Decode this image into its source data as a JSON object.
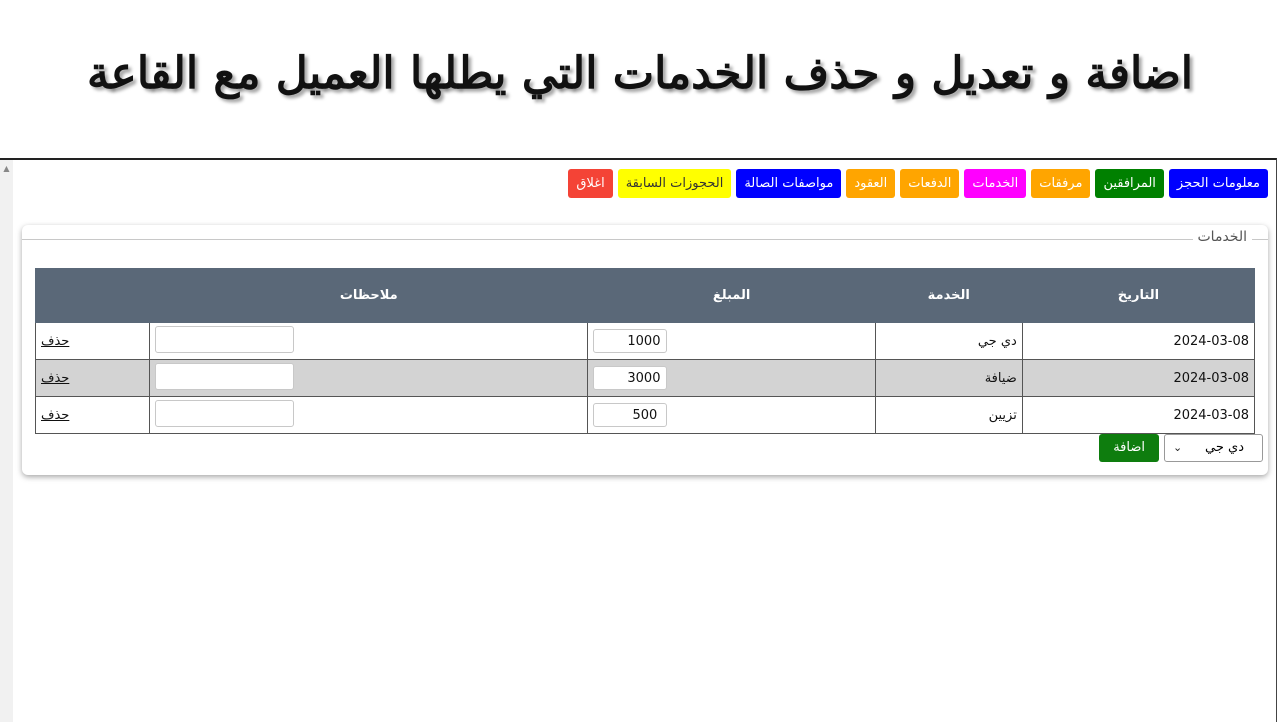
{
  "slide": {
    "title": "اضافة و تعديل و حذف الخدمات التي يطلها العميل مع القاعة"
  },
  "tabs": [
    {
      "label": "معلومات الحجز",
      "bg": "#0000ff",
      "fg": "#ffffff"
    },
    {
      "label": "المرافقين",
      "bg": "#008000",
      "fg": "#ffffff"
    },
    {
      "label": "مرفقات",
      "bg": "#ffa500",
      "fg": "#ffffff"
    },
    {
      "label": "الخدمات",
      "bg": "#ff00ff",
      "fg": "#ffffff"
    },
    {
      "label": "الدفعات",
      "bg": "#ffa500",
      "fg": "#ffffff"
    },
    {
      "label": "العقود",
      "bg": "#ffa500",
      "fg": "#ffffff"
    },
    {
      "label": "مواصفات الصالة",
      "bg": "#0000ff",
      "fg": "#ffffff"
    },
    {
      "label": "الحجوزات السابقة",
      "bg": "#ffff00",
      "fg": "#333333"
    },
    {
      "label": "اغلاق",
      "bg": "#f44336",
      "fg": "#ffffff"
    }
  ],
  "panel": {
    "legend": "الخدمات",
    "columns": [
      "التاريخ",
      "الخدمة",
      "المبلغ",
      "ملاحظات",
      ""
    ],
    "rows": [
      {
        "date": "2024-03-08",
        "service": "دي جي",
        "amount": "1000",
        "notes": "",
        "delete": "حذف"
      },
      {
        "date": "2024-03-08",
        "service": "ضيافة",
        "amount": "3000",
        "notes": "",
        "delete": "حذف"
      },
      {
        "date": "2024-03-08",
        "service": "تزيين",
        "amount": "500",
        "notes": "",
        "delete": "حذف"
      }
    ],
    "add_row": {
      "selected_service": "دي جي",
      "add_label": "اضافة"
    }
  },
  "colors": {
    "header_bg": "#5a6878",
    "alt_row_bg": "#d3d3d3",
    "add_button": "#0e7d0e"
  }
}
